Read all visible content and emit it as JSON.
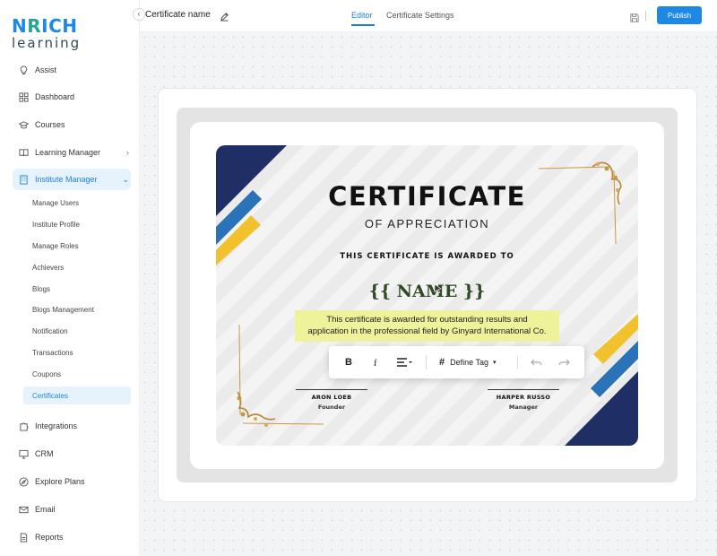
{
  "brand": {
    "logo_top": "NRICH",
    "logo_bottom": "learning",
    "colors": {
      "primary": "#1e88e5",
      "accent": "#26a69a"
    }
  },
  "sidebar": {
    "collapse_icon": "chevron-left-icon",
    "items": [
      {
        "label": "Assist",
        "icon": "lightbulb-icon"
      },
      {
        "label": "Dashboard",
        "icon": "grid-icon"
      },
      {
        "label": "Courses",
        "icon": "graduation-cap-icon"
      },
      {
        "label": "Learning Manager",
        "icon": "book-icon",
        "has_chevron": true
      },
      {
        "label": "Institute Manager",
        "icon": "building-icon",
        "expanded": true
      },
      {
        "label": "Integrations",
        "icon": "puzzle-icon"
      },
      {
        "label": "CRM",
        "icon": "monitor-icon"
      },
      {
        "label": "Explore Plans",
        "icon": "compass-icon"
      },
      {
        "label": "Email",
        "icon": "mail-icon"
      },
      {
        "label": "Reports",
        "icon": "document-icon"
      }
    ],
    "subitems": [
      "Manage Users",
      "Institute Profile",
      "Manage Roles",
      "Achievers",
      "Blogs",
      "Blogs Management",
      "Notification",
      "Transactions",
      "Coupons",
      "Certificates"
    ],
    "active_subitem": "Certificates"
  },
  "topbar": {
    "title": "Certificate name",
    "tabs": [
      {
        "label": "Editor",
        "active": true
      },
      {
        "label": "Certificate Settings",
        "active": false
      }
    ],
    "publish_label": "Publish"
  },
  "certificate": {
    "title": "CERTIFICATE",
    "subtitle": "OF APPRECIATION",
    "awarded_to": "THIS CERTIFICATE IS AWARDED TO",
    "name_placeholder": "{{ NAME }}",
    "description_line1": "This certificate is awarded for outstanding results and",
    "description_line2": "application in the professional field by Ginyard International Co.",
    "signatures": [
      {
        "name": "ARON LOEB",
        "role": "Founder"
      },
      {
        "name": "HARPER RUSSO",
        "role": "Manager"
      }
    ],
    "colors": {
      "navy": "#1f2f66",
      "blue": "#2b73b9",
      "yellow": "#f2c12e",
      "highlight": "#eef29a",
      "gold": "#c8963e"
    }
  },
  "toolbar": {
    "bold": "B",
    "italic": "i",
    "define_tag_label": "Define Tag"
  }
}
